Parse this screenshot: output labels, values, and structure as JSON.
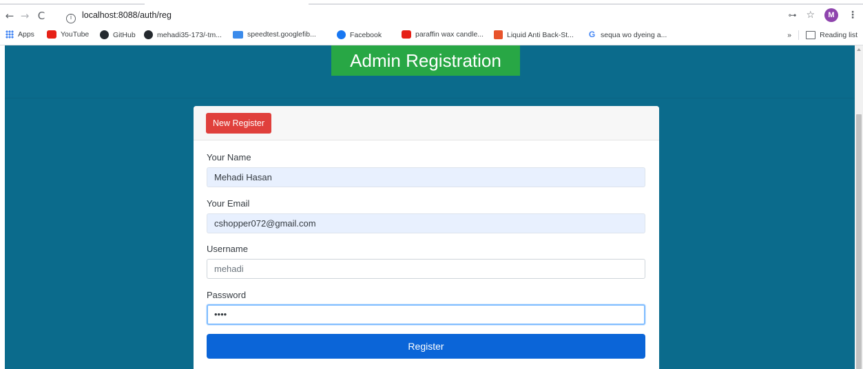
{
  "browser": {
    "url": "localhost:8088/auth/reg",
    "avatar_letter": "M",
    "bookmarks": [
      {
        "label": "Apps",
        "icon": "apps-icon"
      },
      {
        "label": "YouTube",
        "icon": "youtube-icon"
      },
      {
        "label": "GitHub",
        "icon": "github-icon"
      },
      {
        "label": "mehadi35-173/-tm...",
        "icon": "github-icon"
      },
      {
        "label": "speedtest.googlefib...",
        "icon": "speedtest-icon"
      },
      {
        "label": "Facebook",
        "icon": "facebook-icon"
      },
      {
        "label": "paraffin wax candle...",
        "icon": "youtube-icon"
      },
      {
        "label": "Liquid Anti Back-St...",
        "icon": "site-icon"
      },
      {
        "label": "sequa wo dyeing a...",
        "icon": "google-icon"
      }
    ],
    "overflow_label": "»",
    "reading_list_label": "Reading list"
  },
  "page": {
    "title": "Admin Registration",
    "background_color": "#0b6b8c",
    "title_color": "#28a745"
  },
  "form": {
    "header_button": "New Register",
    "name_label": "Your Name",
    "name_value": "Mehadi Hasan",
    "email_label": "Your Email",
    "email_value": "cshopper072@gmail.com",
    "username_label": "Username",
    "username_value": "mehadi",
    "password_label": "Password",
    "password_value": "••••",
    "submit_label": "Register"
  }
}
